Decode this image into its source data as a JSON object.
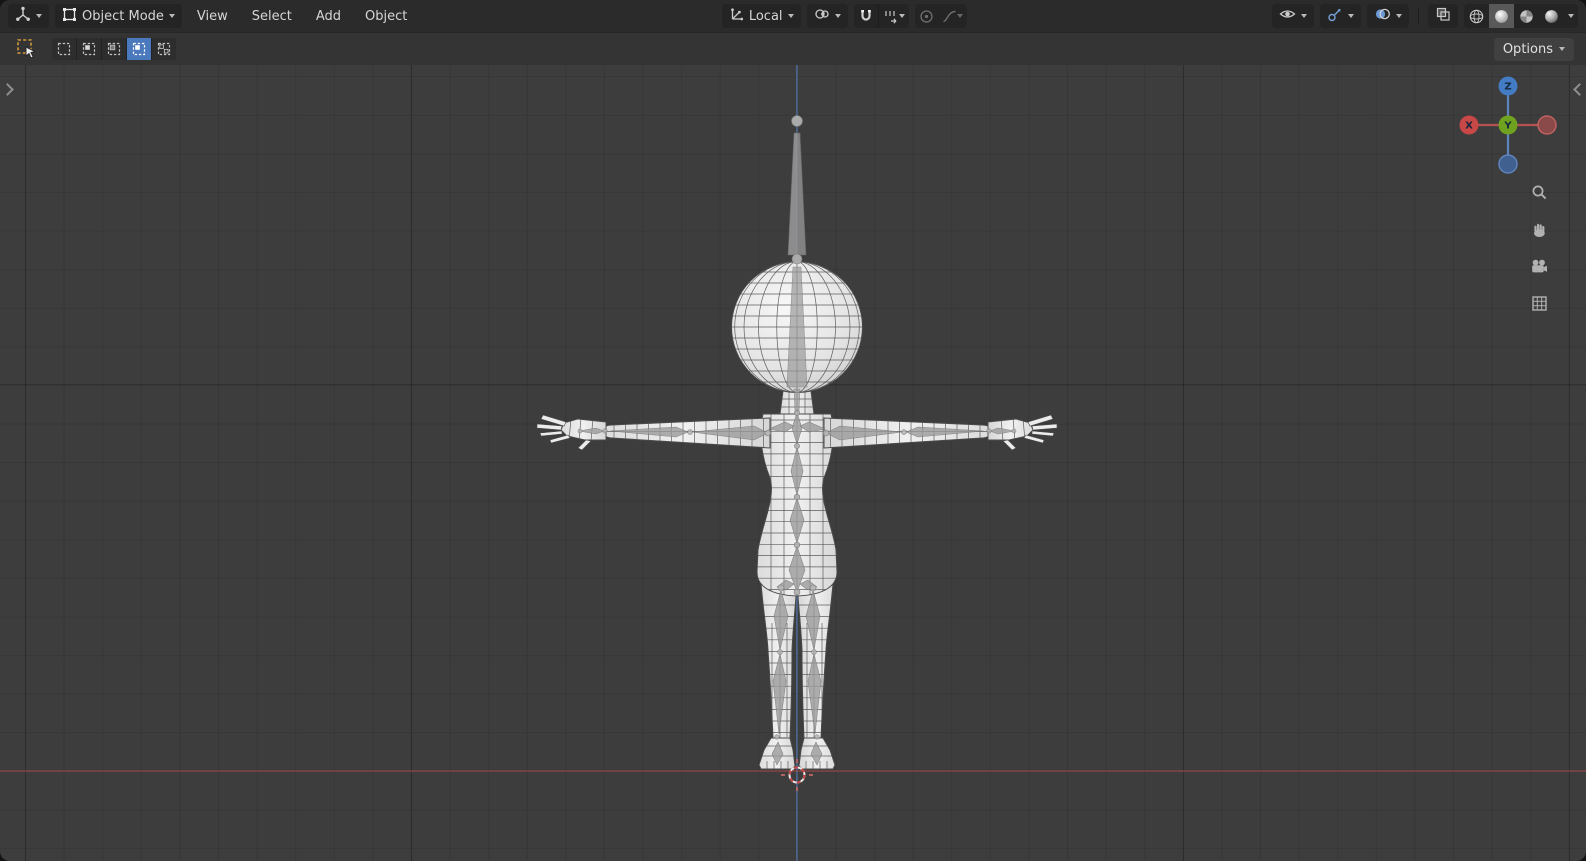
{
  "header": {
    "mode": {
      "label": "Object Mode"
    },
    "menus": [
      {
        "label": "View"
      },
      {
        "label": "Select"
      },
      {
        "label": "Add"
      },
      {
        "label": "Object"
      }
    ],
    "orientation": {
      "label": "Local"
    }
  },
  "toolbar": {
    "options": {
      "label": "Options"
    }
  },
  "nav_gizmo": {
    "x": "X",
    "y": "Y",
    "z": "Z"
  },
  "colors": {
    "accent_blue": "#4772b3",
    "axis_x_red": "#a64d4d",
    "axis_z_blue": "#5a83c0",
    "gizmo_x": "#c84747",
    "gizmo_y": "#6fa31f",
    "gizmo_z": "#437cc4",
    "active_tool_orange": "#cf8a2d",
    "selected_mode_blue": "#4b79bd"
  }
}
